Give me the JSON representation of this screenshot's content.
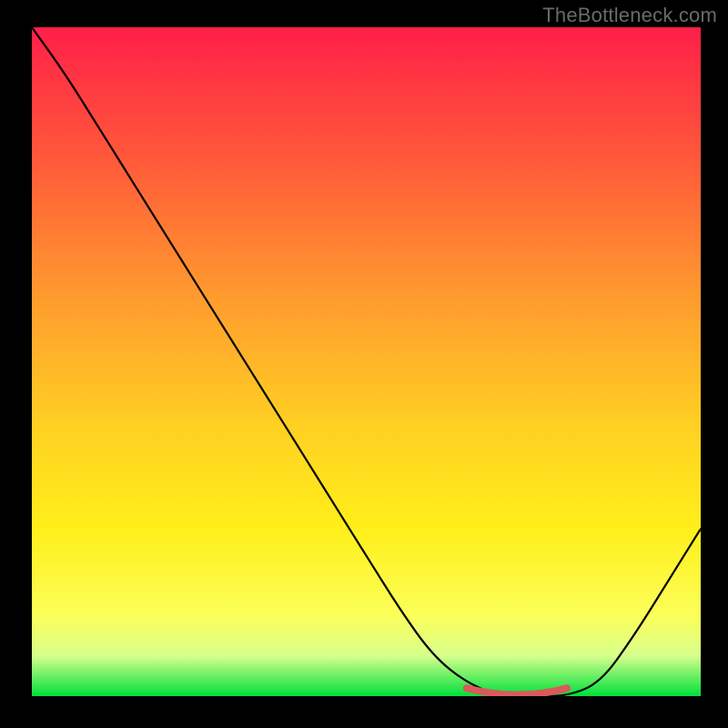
{
  "watermark": "TheBottleneck.com",
  "colors": {
    "background": "#000000",
    "gradient": [
      "#ff1f48",
      "#ff5a3a",
      "#ff9a2e",
      "#ffd122",
      "#ffef1a",
      "#fcff5a",
      "#d6ff8c",
      "#00e03c"
    ],
    "curve": "#000000",
    "marker": "#d85a5a"
  },
  "chart_data": {
    "type": "line",
    "title": "",
    "xlabel": "",
    "ylabel": "",
    "x": [
      0.0,
      0.05,
      0.1,
      0.15,
      0.2,
      0.25,
      0.3,
      0.35,
      0.4,
      0.45,
      0.5,
      0.55,
      0.6,
      0.65,
      0.7,
      0.75,
      0.8,
      0.85,
      0.9,
      0.95,
      1.0
    ],
    "values": [
      1.0,
      0.93,
      0.85,
      0.77,
      0.69,
      0.61,
      0.53,
      0.45,
      0.37,
      0.29,
      0.21,
      0.13,
      0.06,
      0.02,
      0.0,
      0.0,
      0.0,
      0.02,
      0.09,
      0.17,
      0.25
    ],
    "xlim": [
      0,
      1
    ],
    "ylim": [
      0,
      1
    ],
    "minimum_region": {
      "x_start": 0.65,
      "x_end": 0.8,
      "y": 0.0
    },
    "notes": "V-shaped bottleneck curve overlaid on red-to-green vertical gradient; minimum (optimal) plateau highlighted near x≈0.65–0.80."
  }
}
